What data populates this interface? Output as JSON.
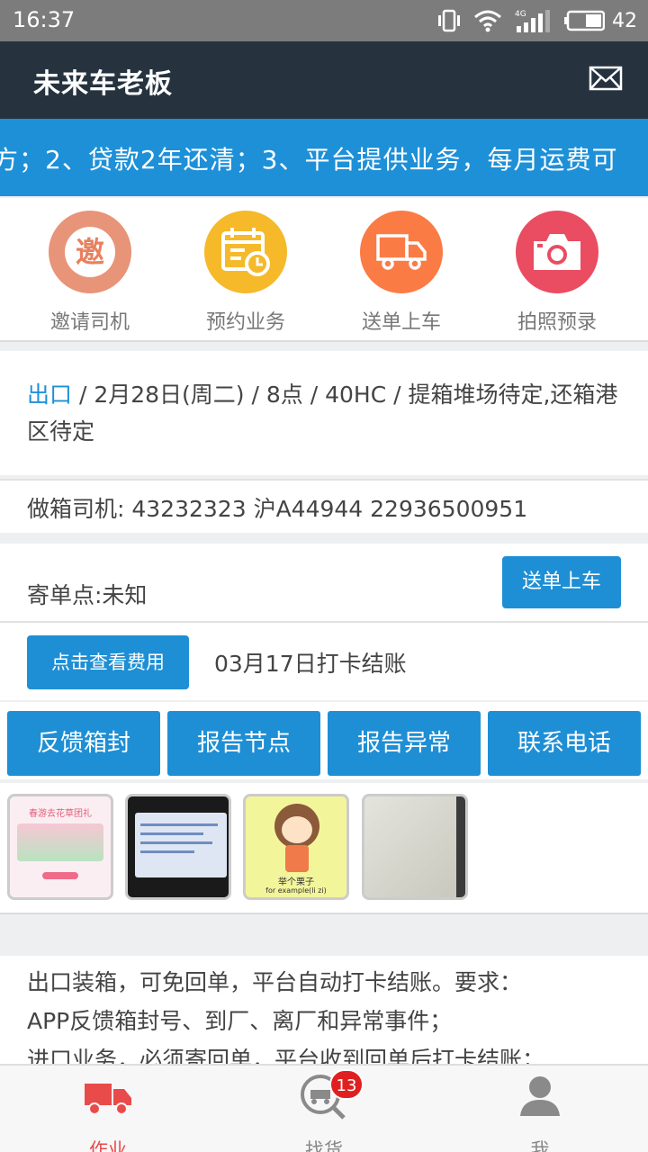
{
  "status_bar": {
    "time": "16:37",
    "battery": "42"
  },
  "app_bar": {
    "title": "未来车老板"
  },
  "marquee": {
    "text": "方；2、贷款2年还清；3、平台提供业务，每月运费可"
  },
  "quick_actions": [
    {
      "label": "邀请司机",
      "icon": "invite-icon",
      "glyph": "邀",
      "color": "#e89478"
    },
    {
      "label": "预约业务",
      "icon": "calendar-icon",
      "color": "#f5b92a"
    },
    {
      "label": "送单上车",
      "icon": "truck-icon",
      "color": "#fb7b45"
    },
    {
      "label": "拍照预录",
      "icon": "camera-icon",
      "color": "#ea4c62"
    }
  ],
  "order": {
    "type": "出口",
    "details": " / 2月28日(周二) / 8点 / 40HC / 提箱堆场待定,还箱港区待定",
    "driver": "做箱司机: 43232323 沪A44944 22936500951",
    "send_point": "寄单点:未知",
    "send_button": "送单上车",
    "fee_button": "点击查看费用",
    "checkout": "03月17日打卡结账"
  },
  "action_buttons": [
    "反馈箱封",
    "报告节点",
    "报告异常",
    "联系电话"
  ],
  "photos": [
    {
      "name": "photo-1",
      "title": "春游去花草团礼"
    },
    {
      "name": "photo-2"
    },
    {
      "name": "photo-3",
      "caption": "举个栗子",
      "caption2": "for example(li zi)"
    },
    {
      "name": "photo-4"
    }
  ],
  "notice": {
    "lines": [
      "出口装箱，可免回单，平台自动打卡结账。要求：",
      "APP反馈箱封号、到厂、离厂和异常事件；",
      "进口业务，必须寄回单，平台收到回单后打卡结账；"
    ]
  },
  "tabs": [
    {
      "label": "作业",
      "active": true
    },
    {
      "label": "找货",
      "badge": "13"
    },
    {
      "label": "我"
    }
  ],
  "colors": {
    "primary": "#1e8fd5",
    "appbar": "#26333f",
    "tab_active": "#e94b4b",
    "badge": "#e02020"
  }
}
